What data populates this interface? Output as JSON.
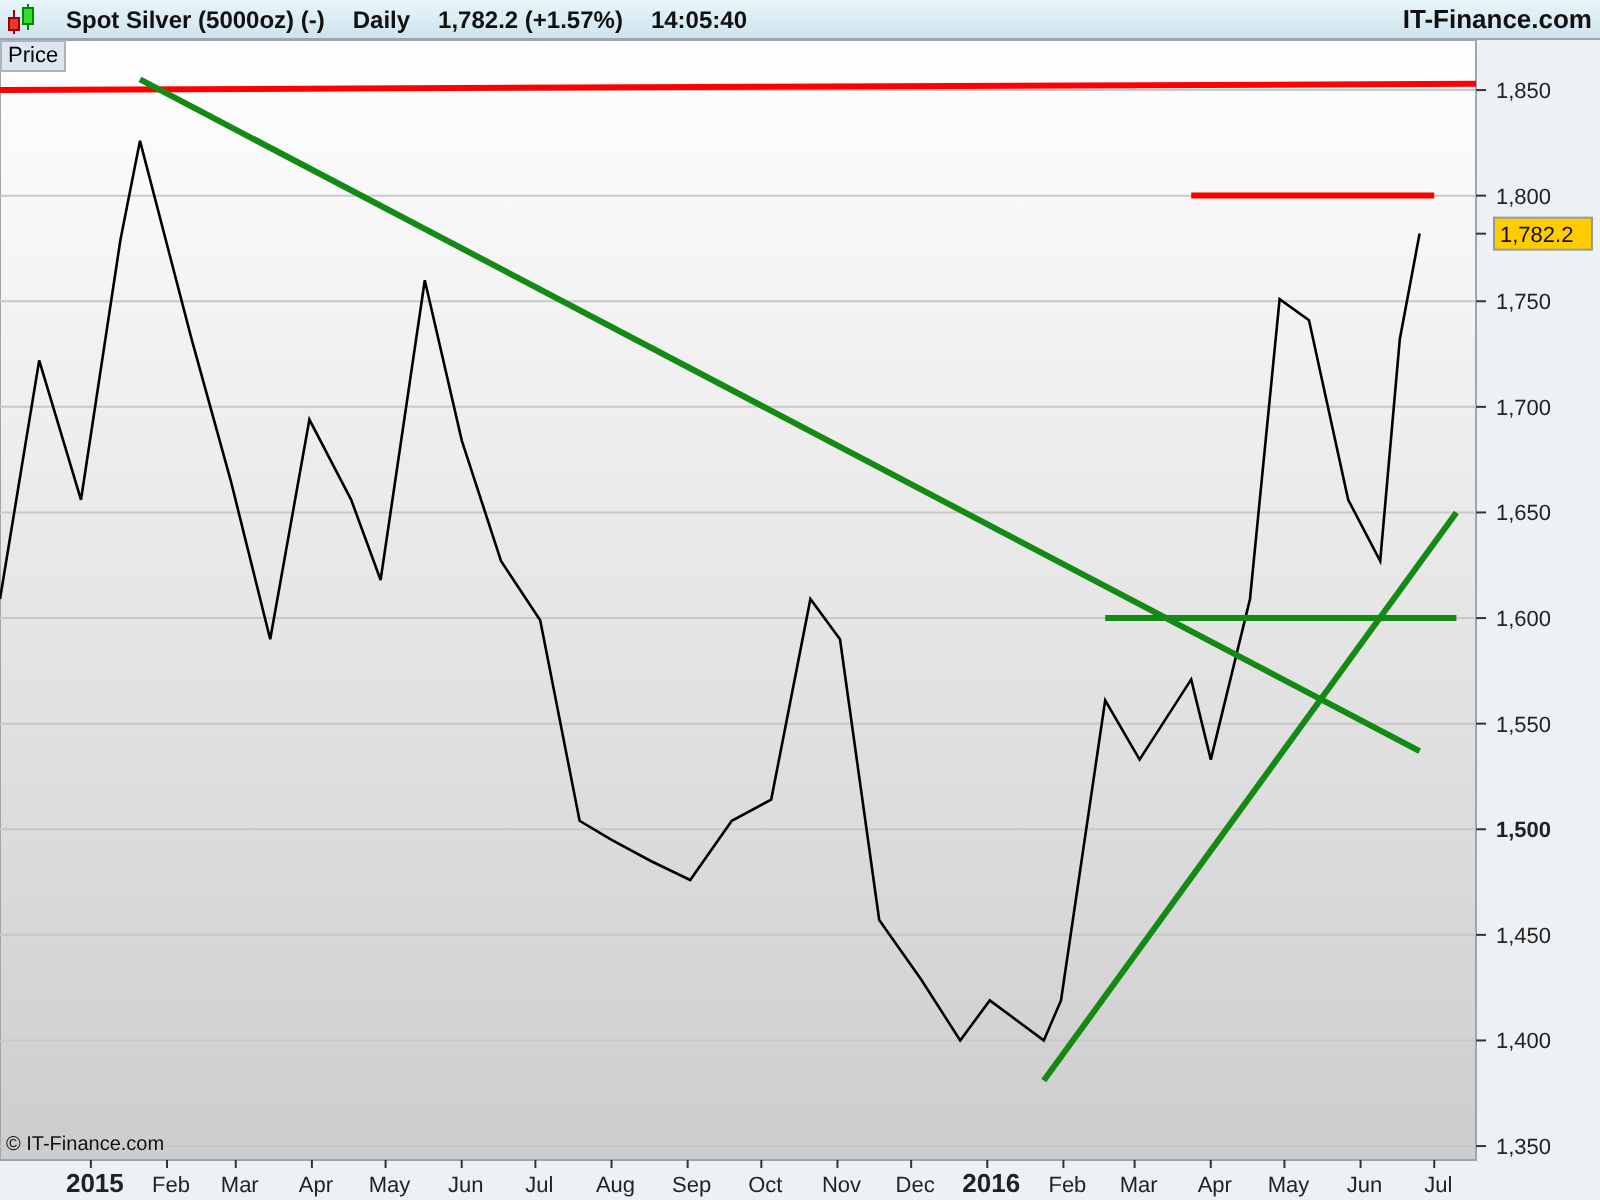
{
  "header": {
    "instrument": "Spot Silver (5000oz) (-)",
    "period": "Daily",
    "quote": "1,782.2 (+1.57%)",
    "time": "14:05:40",
    "brand": "IT-Finance.com"
  },
  "chart": {
    "pane_label": "Price",
    "last_price": "1,782.2",
    "copyright": "© IT-Finance.com",
    "chart_data": {
      "type": "line",
      "grid": true,
      "x": [
        "2014-11-25",
        "2014-12-11",
        "2014-12-28",
        "2015-01-13",
        "2015-01-21",
        "2015-02-11",
        "2015-02-27",
        "2015-03-15",
        "2015-03-31",
        "2015-04-17",
        "2015-04-29",
        "2015-05-17",
        "2015-06-01",
        "2015-06-17",
        "2015-07-03",
        "2015-07-19",
        "2015-08-01",
        "2015-08-17",
        "2015-09-02",
        "2015-09-19",
        "2015-10-05",
        "2015-10-21",
        "2015-11-02",
        "2015-11-18",
        "2015-12-05",
        "2015-12-21",
        "2016-01-02",
        "2016-01-24",
        "2016-01-31",
        "2016-02-18",
        "2016-03-03",
        "2016-03-24",
        "2016-04-01",
        "2016-04-17",
        "2016-04-29",
        "2016-05-11",
        "2016-05-27",
        "2016-06-09",
        "2016-06-17",
        "2016-06-25",
        "2016-07-01",
        "2016-07-10",
        "2016-07-18"
      ],
      "series": [
        {
          "color": "#000000",
          "values": [
            1609,
            1722,
            1656,
            1779,
            1826,
            1732,
            1665,
            1590,
            1694,
            1656,
            1618,
            1760,
            1684,
            1627,
            1599,
            1504,
            1495,
            1485,
            1476,
            1504,
            1514,
            1609,
            1590,
            1457,
            1429,
            1400,
            1419,
            1400,
            1419,
            1561,
            1533,
            1571,
            1533,
            1609,
            1751,
            1741,
            1656,
            1627,
            1732,
            1782,
            null,
            null,
            null
          ]
        },
        {
          "color": "#ff0000",
          "values": [
            1850,
            null,
            null,
            null,
            null,
            null,
            null,
            null,
            null,
            null,
            null,
            null,
            null,
            null,
            null,
            null,
            null,
            null,
            null,
            null,
            null,
            null,
            null,
            null,
            null,
            null,
            null,
            null,
            null,
            null,
            null,
            null,
            null,
            null,
            null,
            null,
            null,
            null,
            null,
            null,
            null,
            null,
            1853
          ]
        },
        {
          "color": "#ff0000",
          "values": [
            null,
            null,
            null,
            null,
            null,
            null,
            null,
            null,
            null,
            null,
            null,
            null,
            null,
            null,
            null,
            null,
            null,
            null,
            null,
            null,
            null,
            null,
            null,
            null,
            null,
            null,
            null,
            null,
            null,
            null,
            null,
            1800,
            null,
            null,
            null,
            null,
            null,
            null,
            null,
            null,
            1800,
            null,
            null
          ]
        },
        {
          "color": "#138a13",
          "values": [
            null,
            null,
            null,
            null,
            1855,
            null,
            null,
            null,
            null,
            null,
            null,
            null,
            null,
            null,
            null,
            null,
            null,
            null,
            null,
            null,
            null,
            null,
            null,
            null,
            null,
            null,
            null,
            null,
            null,
            null,
            null,
            null,
            null,
            null,
            null,
            null,
            null,
            null,
            null,
            1537,
            null,
            null,
            null
          ]
        },
        {
          "color": "#138a13",
          "values": [
            null,
            null,
            null,
            null,
            null,
            null,
            null,
            null,
            null,
            null,
            null,
            null,
            null,
            null,
            null,
            null,
            null,
            null,
            null,
            null,
            null,
            null,
            null,
            null,
            null,
            null,
            null,
            null,
            null,
            1600,
            null,
            null,
            null,
            null,
            null,
            null,
            null,
            null,
            null,
            null,
            null,
            1600,
            null
          ]
        },
        {
          "color": "#138a13",
          "values": [
            null,
            null,
            null,
            null,
            null,
            null,
            null,
            null,
            null,
            null,
            null,
            null,
            null,
            null,
            null,
            null,
            null,
            null,
            null,
            null,
            null,
            null,
            null,
            null,
            null,
            null,
            null,
            1381,
            null,
            null,
            null,
            null,
            null,
            null,
            null,
            null,
            null,
            null,
            null,
            null,
            null,
            1650,
            null
          ]
        }
      ],
      "xlim": [
        "2014-11-25",
        "2016-07-18"
      ],
      "ylim": [
        1343.4,
        1873.7
      ],
      "xticks": [
        {
          "value": "2015-01-01",
          "label": "2015"
        },
        {
          "value": "2015-02-01",
          "label": "Feb"
        },
        {
          "value": "2015-03-01",
          "label": "Mar"
        },
        {
          "value": "2015-04-01",
          "label": "Apr"
        },
        {
          "value": "2015-05-01",
          "label": "May"
        },
        {
          "value": "2015-06-01",
          "label": "Jun"
        },
        {
          "value": "2015-07-01",
          "label": "Jul"
        },
        {
          "value": "2015-08-01",
          "label": "Aug"
        },
        {
          "value": "2015-09-01",
          "label": "Sep"
        },
        {
          "value": "2015-10-01",
          "label": "Oct"
        },
        {
          "value": "2015-11-01",
          "label": "Nov"
        },
        {
          "value": "2015-12-01",
          "label": "Dec"
        },
        {
          "value": "2016-01-01",
          "label": "2016"
        },
        {
          "value": "2016-02-01",
          "label": "Feb"
        },
        {
          "value": "2016-03-01",
          "label": "Mar"
        },
        {
          "value": "2016-04-01",
          "label": "Apr"
        },
        {
          "value": "2016-05-01",
          "label": "May"
        },
        {
          "value": "2016-06-01",
          "label": "Jun"
        },
        {
          "value": "2016-07-01",
          "label": "Jul"
        }
      ],
      "yticks": [
        {
          "value": 1350,
          "label": "1,350"
        },
        {
          "value": 1400,
          "label": "1,400"
        },
        {
          "value": 1450,
          "label": "1,450"
        },
        {
          "value": 1500,
          "label": "1,500"
        },
        {
          "value": 1550,
          "label": "1,550"
        },
        {
          "value": 1600,
          "label": "1,600"
        },
        {
          "value": 1650,
          "label": "1,650"
        },
        {
          "value": 1700,
          "label": "1,700"
        },
        {
          "value": 1750,
          "label": "1,750"
        },
        {
          "value": 1800,
          "label": "1,800"
        },
        {
          "value": 1850,
          "label": "1,850"
        }
      ]
    }
  }
}
